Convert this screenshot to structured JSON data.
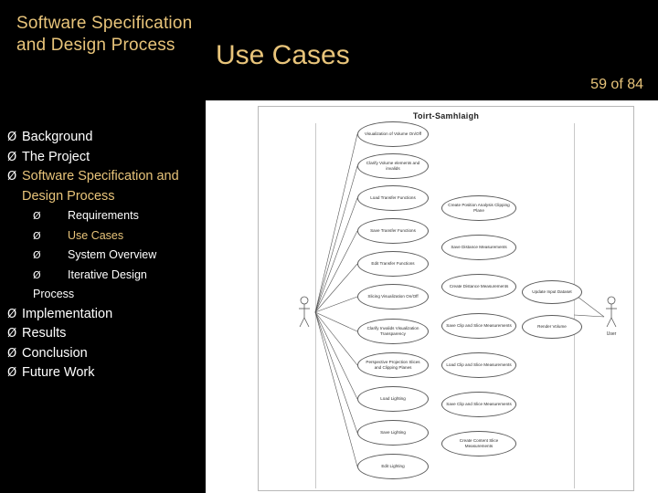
{
  "slide": {
    "title": "Software Specification and Design Process",
    "header_title": "Use Cases",
    "counter": "59 of 84"
  },
  "outline": {
    "items": [
      {
        "text": "Background",
        "level": 1,
        "highlight": false,
        "bullet": "Ø"
      },
      {
        "text": "The Project",
        "level": 1,
        "highlight": false,
        "bullet": "Ø"
      },
      {
        "text": "Software Specification and Design Process",
        "level": 1,
        "highlight": true,
        "bullet": "Ø"
      },
      {
        "text": "Requirements",
        "level": 2,
        "highlight": false,
        "bullet": "Ø"
      },
      {
        "text": "Use Cases",
        "level": 2,
        "highlight": true,
        "bullet": "Ø"
      },
      {
        "text": "System Overview",
        "level": 2,
        "highlight": false,
        "bullet": "Ø"
      },
      {
        "text": "Iterative Design",
        "level": 2,
        "highlight": false,
        "bullet": "Ø"
      },
      {
        "text": "Process",
        "level": 2,
        "continuation": true,
        "highlight": false,
        "bullet": ""
      },
      {
        "text": "Implementation",
        "level": 1,
        "highlight": false,
        "bullet": "Ø"
      },
      {
        "text": "Results",
        "level": 1,
        "highlight": false,
        "bullet": "Ø"
      },
      {
        "text": "Conclusion",
        "level": 1,
        "highlight": false,
        "bullet": "Ø"
      },
      {
        "text": "Future Work",
        "level": 1,
        "highlight": false,
        "bullet": "Ø"
      }
    ]
  },
  "diagram": {
    "title": "Toirt-Samhlaigh",
    "actors": [
      {
        "name": "primary-actor",
        "label": ""
      },
      {
        "name": "secondary-actor",
        "label": "User"
      }
    ],
    "use_cases": [
      {
        "id": "uc1",
        "label": "Visualization of Volume On/Off"
      },
      {
        "id": "uc2",
        "label": "Clarify Volume elements and invalids"
      },
      {
        "id": "uc3",
        "label": "Load Transfer Functions"
      },
      {
        "id": "uc4",
        "label": "Save Transfer Functions"
      },
      {
        "id": "uc5",
        "label": "Edit Transfer Functions"
      },
      {
        "id": "uc6",
        "label": "Slicing Visualization On/Off"
      },
      {
        "id": "uc7",
        "label": "Clarify Invalids Visualization Transparency"
      },
      {
        "id": "uc8",
        "label": "Perspective Projection Slices and Clipping Planes"
      },
      {
        "id": "uc9",
        "label": "Load Lighting"
      },
      {
        "id": "uc10",
        "label": "Save Lighting"
      },
      {
        "id": "uc11",
        "label": "Edit Lighting"
      },
      {
        "id": "uc12",
        "label": "Create Position Analysis Clipping Plane"
      },
      {
        "id": "uc13",
        "label": "Save Distance Measurements"
      },
      {
        "id": "uc14",
        "label": "Create Distance Measurements"
      },
      {
        "id": "uc15",
        "label": "Save Clip and Slice Measurements"
      },
      {
        "id": "uc16",
        "label": "Load Clip and Slice Measurements"
      },
      {
        "id": "uc17",
        "label": "Save Clip and Slice Measurements"
      },
      {
        "id": "uc18",
        "label": "Create Content Slice Measurements"
      },
      {
        "id": "uc19",
        "label": "Update Input Dataset"
      },
      {
        "id": "uc20",
        "label": "Render Volume"
      }
    ]
  }
}
